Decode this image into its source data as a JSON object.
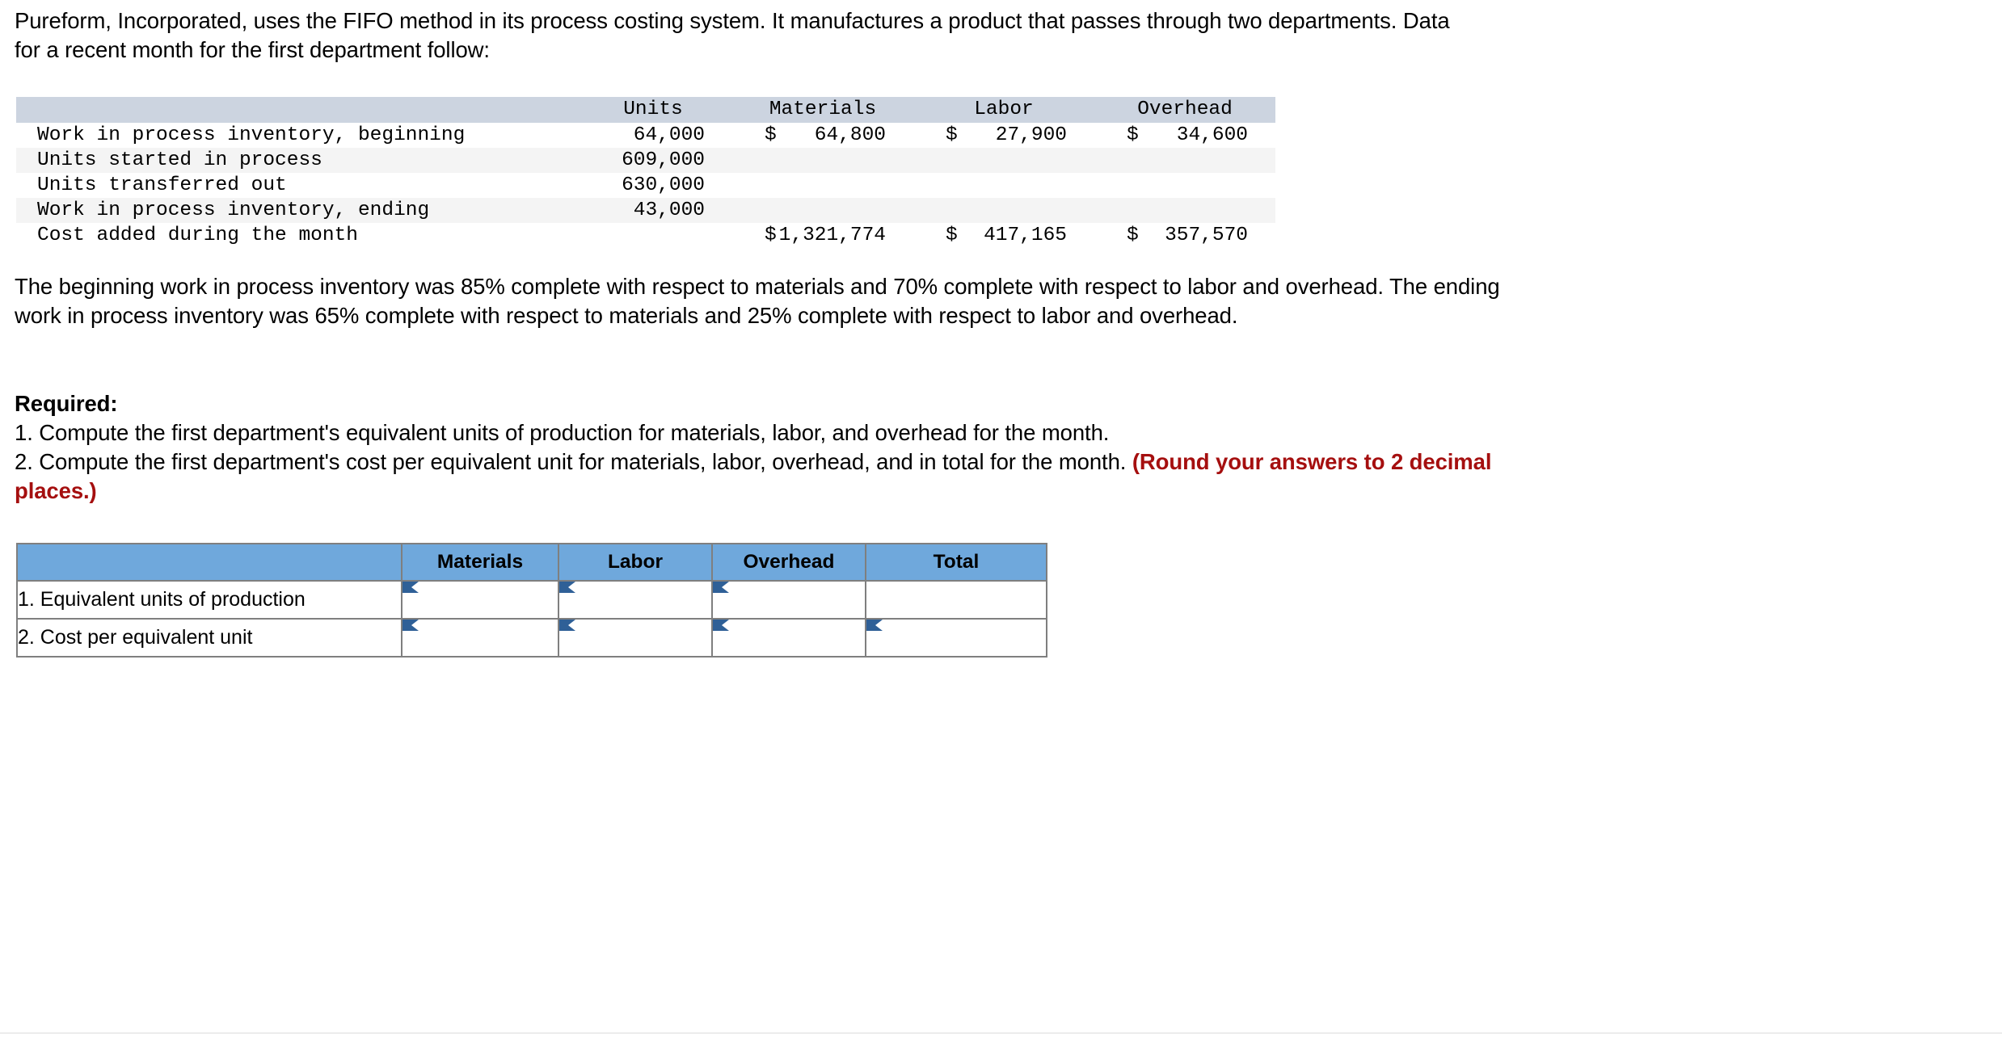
{
  "intro": {
    "paragraph": "Pureform, Incorporated, uses the FIFO method in its process costing system. It manufactures a product that passes through two departments. Data for a recent month for the first department follow:"
  },
  "fact_table": {
    "columns": [
      "",
      "Units",
      "Materials",
      "Labor",
      "Overhead"
    ],
    "rows": [
      {
        "label": "Work in process inventory, beginning",
        "units": "64,000",
        "materials_currency": "$",
        "materials": "64,800",
        "labor_currency": "$",
        "labor": "27,900",
        "overhead_currency": "$",
        "overhead": "34,600"
      },
      {
        "label": "Units started in process",
        "units": "609,000",
        "materials_currency": "",
        "materials": "",
        "labor_currency": "",
        "labor": "",
        "overhead_currency": "",
        "overhead": ""
      },
      {
        "label": "Units transferred out",
        "units": "630,000",
        "materials_currency": "",
        "materials": "",
        "labor_currency": "",
        "labor": "",
        "overhead_currency": "",
        "overhead": ""
      },
      {
        "label": "Work in process inventory, ending",
        "units": "43,000",
        "materials_currency": "",
        "materials": "",
        "labor_currency": "",
        "labor": "",
        "overhead_currency": "",
        "overhead": ""
      },
      {
        "label": "Cost added during the month",
        "units": "",
        "materials_currency": "$",
        "materials": "1,321,774",
        "labor_currency": "$",
        "labor": "417,165",
        "overhead_currency": "$",
        "overhead": "357,570"
      }
    ]
  },
  "mid_paragraph": {
    "text": "The beginning work in process inventory was 85% complete with respect to materials and 70% complete with respect to labor and overhead. The ending work in process inventory was 65% complete with respect to materials and 25% complete with respect to labor and overhead."
  },
  "required": {
    "heading": "Required:",
    "item1": "1. Compute the first department's equivalent units of production for materials, labor, and overhead for the month.",
    "item2_main": "2. Compute the first department's cost per equivalent unit for materials, labor, overhead, and in total for the month. ",
    "item2_note": "(Round your answers to 2 decimal places.)"
  },
  "answer_table": {
    "header_blank": "",
    "headers": [
      "Materials",
      "Labor",
      "Overhead",
      "Total"
    ],
    "rows": [
      {
        "label": "1. Equivalent units of production",
        "materials": "",
        "labor": "",
        "overhead": "",
        "total": ""
      },
      {
        "label": "2. Cost per equivalent unit",
        "materials": "",
        "labor": "",
        "overhead": "",
        "total": ""
      }
    ]
  },
  "colors": {
    "fact_header_bg": "#ccd4e0",
    "fact_alt_row_bg": "#f4f4f4",
    "answer_header_bg": "#6fa8dc",
    "answer_border": "#7f7f7f",
    "input_border": "#3a6ea5",
    "input_marker": "#2f6097",
    "note_red": "#a50f0f"
  }
}
